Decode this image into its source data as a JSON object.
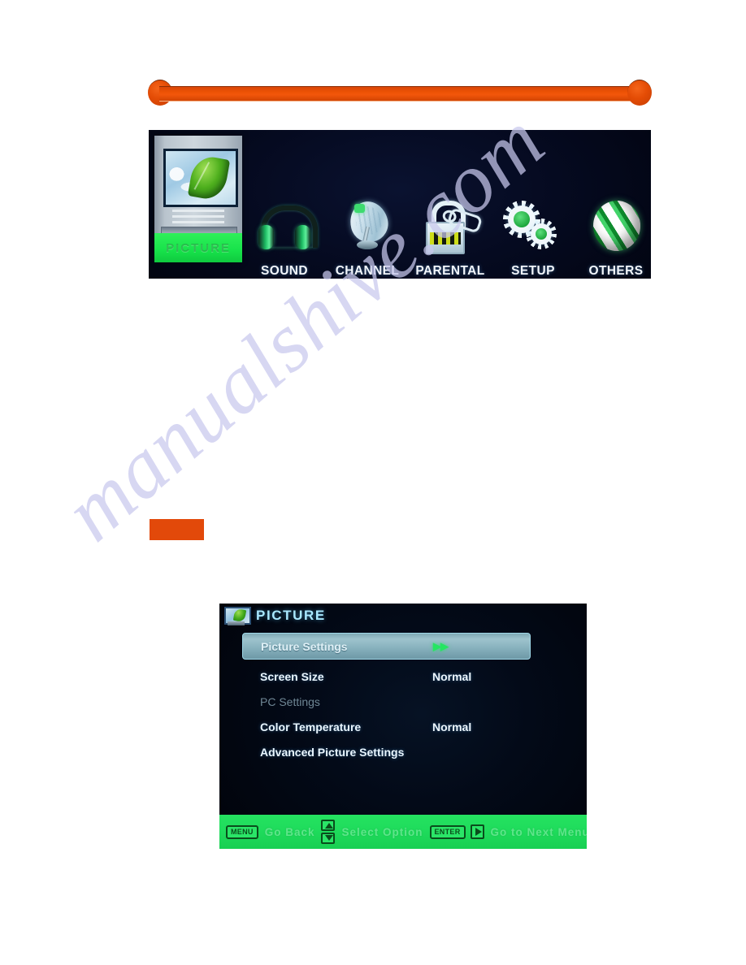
{
  "page": {
    "background_color": "#ffffff",
    "accent_color": "#e2490a",
    "watermark": "manualshive.com"
  },
  "divider_rule": {
    "name": "orange-rule",
    "color": "#ec5204"
  },
  "orange_block": {
    "label": "",
    "color": "#e2490a"
  },
  "main_menu": {
    "name": "tv-main-menu",
    "background_color": "#050a20",
    "items": [
      {
        "label": "PICTURE",
        "icon": "picture-monitor-leaf-icon",
        "selected": true
      },
      {
        "label": "SOUND",
        "icon": "headphones-icon",
        "selected": false
      },
      {
        "label": "CHANNEL",
        "icon": "satellite-dish-icon",
        "selected": false
      },
      {
        "label": "PARENTAL",
        "icon": "padlock-key-icon",
        "selected": false
      },
      {
        "label": "SETUP",
        "icon": "gears-icon",
        "selected": false
      },
      {
        "label": "OTHERS",
        "icon": "striped-globe-icon",
        "selected": false
      }
    ]
  },
  "osd": {
    "name": "picture-osd-panel",
    "title": "PICTURE",
    "title_icon": "picture-monitor-leaf-icon",
    "accent_color": "#a9e8ff",
    "highlight_color": "#9dc3cd",
    "rows": [
      {
        "label": "Picture Settings",
        "value": "▶▶",
        "selected": true,
        "disabled": false
      },
      {
        "label": "Screen Size",
        "value": "Normal",
        "selected": false,
        "disabled": false
      },
      {
        "label": "PC Settings",
        "value": "",
        "selected": false,
        "disabled": true
      },
      {
        "label": "Color Temperature",
        "value": "Normal",
        "selected": false,
        "disabled": false
      },
      {
        "label": "Advanced Picture Settings",
        "value": "",
        "selected": false,
        "disabled": false
      }
    ],
    "hint_bar": {
      "background_color": "#1fdc5c",
      "menu_key": "MENU",
      "menu_action": "Go Back",
      "updown_action": "Select Option",
      "enter_key": "ENTER",
      "enter_action": "Go to Next Menu"
    }
  }
}
